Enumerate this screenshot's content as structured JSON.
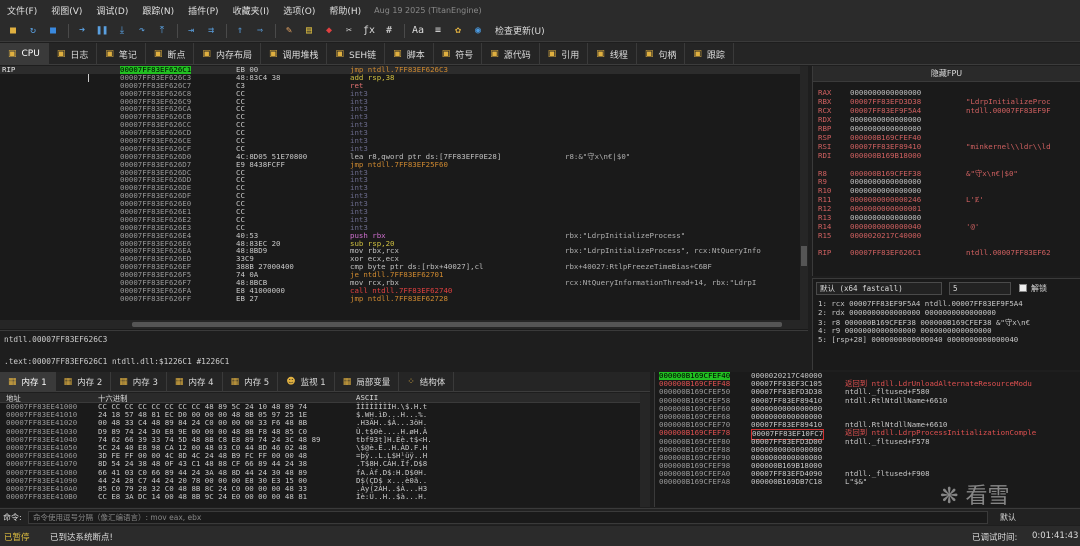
{
  "menubar": {
    "items": [
      "文件(F)",
      "视图(V)",
      "调试(D)",
      "跟踪(N)",
      "插件(P)",
      "收藏夹(I)",
      "选项(O)",
      "帮助(H)"
    ],
    "version": "Aug 19 2025 (TitanEngine)"
  },
  "toolbar": {
    "update_label": "检查更新(U)"
  },
  "tabs": [
    {
      "label": "CPU",
      "icon": "cpu-icon"
    },
    {
      "label": "日志",
      "icon": "log-icon"
    },
    {
      "label": "笔记",
      "icon": "notes-icon"
    },
    {
      "label": "断点",
      "icon": "breakpoint-icon"
    },
    {
      "label": "内存布局",
      "icon": "memory-map-icon"
    },
    {
      "label": "调用堆栈",
      "icon": "call-stack-icon"
    },
    {
      "label": "SEH链",
      "icon": "seh-icon"
    },
    {
      "label": "脚本",
      "icon": "script-icon"
    },
    {
      "label": "符号",
      "icon": "symbols-icon"
    },
    {
      "label": "源代码",
      "icon": "source-icon"
    },
    {
      "label": "引用",
      "icon": "references-icon"
    },
    {
      "label": "线程",
      "icon": "threads-icon"
    },
    {
      "label": "句柄",
      "icon": "handles-icon"
    },
    {
      "label": "跟踪",
      "icon": "trace-icon"
    }
  ],
  "cpu": {
    "rip_label": "RIP",
    "rows": [
      {
        "addr": "00007FF83EF626C1",
        "bytes": "EB 00",
        "asm": "jmp ntdll.7FF83EF626C3",
        "cls": "asm-jmp",
        "cmt": ""
      },
      {
        "addr": "00007FF83EF626C3",
        "bytes": "48:83C4 38",
        "asm": "add rsp,38",
        "cls": "asm-add",
        "cmt": ""
      },
      {
        "addr": "00007FF83EF626C7",
        "bytes": "C3",
        "asm": "ret",
        "cls": "asm-ret",
        "cmt": ""
      },
      {
        "addr": "00007FF83EF626C8",
        "bytes": "CC",
        "asm": "int3",
        "cls": "asm-int",
        "cmt": ""
      },
      {
        "addr": "00007FF83EF626C9",
        "bytes": "CC",
        "asm": "int3",
        "cls": "asm-int",
        "cmt": ""
      },
      {
        "addr": "00007FF83EF626CA",
        "bytes": "CC",
        "asm": "int3",
        "cls": "asm-int",
        "cmt": ""
      },
      {
        "addr": "00007FF83EF626CB",
        "bytes": "CC",
        "asm": "int3",
        "cls": "asm-int",
        "cmt": ""
      },
      {
        "addr": "00007FF83EF626CC",
        "bytes": "CC",
        "asm": "int3",
        "cls": "asm-int",
        "cmt": ""
      },
      {
        "addr": "00007FF83EF626CD",
        "bytes": "CC",
        "asm": "int3",
        "cls": "asm-int",
        "cmt": ""
      },
      {
        "addr": "00007FF83EF626CE",
        "bytes": "CC",
        "asm": "int3",
        "cls": "asm-int",
        "cmt": ""
      },
      {
        "addr": "00007FF83EF626CF",
        "bytes": "CC",
        "asm": "int3",
        "cls": "asm-int",
        "cmt": ""
      },
      {
        "addr": "00007FF83EF626D0",
        "bytes": "4C:8D05 51E70800",
        "asm": "lea r8,qword ptr ds:[7FF83EFF0E28]",
        "cls": "asm-lea",
        "cmt": "r8:&\"守x\\n€|$0\""
      },
      {
        "addr": "00007FF83EF626D7",
        "bytes": "E9 8438FCFF",
        "asm": "jmp ntdll.7FF83EF25F60",
        "cls": "asm-jmp",
        "cmt": ""
      },
      {
        "addr": "00007FF83EF626DC",
        "bytes": "CC",
        "asm": "int3",
        "cls": "asm-int",
        "cmt": ""
      },
      {
        "addr": "00007FF83EF626DD",
        "bytes": "CC",
        "asm": "int3",
        "cls": "asm-int",
        "cmt": ""
      },
      {
        "addr": "00007FF83EF626DE",
        "bytes": "CC",
        "asm": "int3",
        "cls": "asm-int",
        "cmt": ""
      },
      {
        "addr": "00007FF83EF626DF",
        "bytes": "CC",
        "asm": "int3",
        "cls": "asm-int",
        "cmt": ""
      },
      {
        "addr": "00007FF83EF626E0",
        "bytes": "CC",
        "asm": "int3",
        "cls": "asm-int",
        "cmt": ""
      },
      {
        "addr": "00007FF83EF626E1",
        "bytes": "CC",
        "asm": "int3",
        "cls": "asm-int",
        "cmt": ""
      },
      {
        "addr": "00007FF83EF626E2",
        "bytes": "CC",
        "asm": "int3",
        "cls": "asm-int",
        "cmt": ""
      },
      {
        "addr": "00007FF83EF626E3",
        "bytes": "CC",
        "asm": "int3",
        "cls": "asm-int",
        "cmt": ""
      },
      {
        "addr": "00007FF83EF626E4",
        "bytes": "40:53",
        "asm": "push rbx",
        "cls": "asm-push",
        "cmt": "rbx:\"LdrpInitializeProcess\""
      },
      {
        "addr": "00007FF83EF626E6",
        "bytes": "48:83EC 20",
        "asm": "sub rsp,20",
        "cls": "asm-sub",
        "cmt": ""
      },
      {
        "addr": "00007FF83EF626EA",
        "bytes": "48:8BD9",
        "asm": "mov rbx,rcx",
        "cls": "asm-mov",
        "cmt": "rbx:\"LdrpInitializeProcess\", rcx:NtQueryInfo"
      },
      {
        "addr": "00007FF83EF626ED",
        "bytes": "33C9",
        "asm": "xor ecx,ecx",
        "cls": "asm-xor",
        "cmt": ""
      },
      {
        "addr": "00007FF83EF626EF",
        "bytes": "388B 27000400",
        "asm": "cmp byte ptr ds:[rbx+40027],cl",
        "cls": "asm-cmp",
        "cmt": "rbx+40027:RtlpFreezeTimeBias+C6BF"
      },
      {
        "addr": "00007FF83EF626F5",
        "bytes": "74 0A",
        "asm": "je ntdll.7FF83EF62701",
        "cls": "asm-je",
        "cmt": ""
      },
      {
        "addr": "00007FF83EF626F7",
        "bytes": "48:8BCB",
        "asm": "mov rcx,rbx",
        "cls": "asm-mov",
        "cmt": "rcx:NtQueryInformationThread+14, rbx:\"LdrpI"
      },
      {
        "addr": "00007FF83EF626FA",
        "bytes": "E8 41000000",
        "asm": "call ntdll.7FF83EF62740",
        "cls": "asm-call",
        "cmt": ""
      },
      {
        "addr": "00007FF83EF626FF",
        "bytes": "EB 27",
        "asm": "jmp ntdll.7FF83EF62728",
        "cls": "asm-jmp",
        "cmt": ""
      }
    ]
  },
  "info": {
    "line1": "ntdll.00007FF83EF626C3",
    "line2": ".text:00007FF83EF626C1 ntdll.dll:$1226C1 #1226C1"
  },
  "regs": {
    "header": "隐藏FPU",
    "list": [
      {
        "n": "RAX",
        "v": "0000000000000000",
        "s": ""
      },
      {
        "n": "RBX",
        "v": "00007FF83EFD3D38",
        "s": "\"LdrpInitializeProc"
      },
      {
        "n": "RCX",
        "v": "00007FF83EF9F5A4",
        "s": "ntdll.00007FF83EF9F"
      },
      {
        "n": "RDX",
        "v": "0000000000000000",
        "s": ""
      },
      {
        "n": "RBP",
        "v": "0000000000000000",
        "s": ""
      },
      {
        "n": "RSP",
        "v": "000000B169CFEF40",
        "s": ""
      },
      {
        "n": "RSI",
        "v": "00007FF83EF89410",
        "s": "\"minkernel\\\\ldr\\\\ld"
      },
      {
        "n": "RDI",
        "v": "000000B169B18000",
        "s": ""
      },
      {
        "n": "R8",
        "v": "000000B169CFEF38",
        "s": "&\"守x\\n€|$0\""
      },
      {
        "n": "R9",
        "v": "0000000000000000",
        "s": ""
      },
      {
        "n": "R10",
        "v": "0000000000000000",
        "s": ""
      },
      {
        "n": "R11",
        "v": "0000000000000246",
        "s": "L'Ɇ'"
      },
      {
        "n": "R12",
        "v": "0000000000000001",
        "s": ""
      },
      {
        "n": "R13",
        "v": "0000000000000000",
        "s": ""
      },
      {
        "n": "R14",
        "v": "0000000000000040",
        "s": "'@'"
      },
      {
        "n": "R15",
        "v": "0000020217C40000",
        "s": ""
      },
      {
        "n": "RIP",
        "v": "00007FF83EF626C1",
        "s": "ntdll.00007FF83EF62"
      }
    ]
  },
  "callconv": {
    "mode": "默认 (x64 fastcall)",
    "count": "5",
    "unlock": "解锁",
    "lines": [
      "1: rcx 00007FF83EF9F5A4 ntdll.00007FF83EF9F5A4",
      "2: rdx 0000000000000000 0000000000000000",
      "3: r8 000000B169CFEF38 000000B169CFEF38 &\"守x\\n€",
      "4: r9 0000000000000000 0000000000000000",
      "5: [rsp+28] 0000000000000040 0000000000000040"
    ]
  },
  "btabs": [
    {
      "label": "内存 1",
      "icon": "memory-icon"
    },
    {
      "label": "内存 2",
      "icon": "memory-icon"
    },
    {
      "label": "内存 3",
      "icon": "memory-icon"
    },
    {
      "label": "内存 4",
      "icon": "memory-icon"
    },
    {
      "label": "内存 5",
      "icon": "memory-icon"
    },
    {
      "label": "监视 1",
      "icon": "watch-icon"
    },
    {
      "label": "局部变量",
      "icon": "locals-icon"
    },
    {
      "label": "结构体",
      "icon": "struct-icon"
    }
  ],
  "dump": {
    "headers": [
      "地址",
      "十六进制",
      "ASCII"
    ],
    "rows": [
      {
        "a": "00007FF83EE41000",
        "h": "CC CC CC CC CC CC CC CC 48 89 5C 24 10 48 89 74",
        "t": "ÌÌÌÌÌÌÌÌH.\\$.H.t"
      },
      {
        "a": "00007FF83EE41010",
        "h": "24 18 57 48 81 EC D0 00 00 00 48 8B 05 97 25 1E",
        "t": "$.WH.ìÐ...H...%."
      },
      {
        "a": "00007FF83EE41020",
        "h": "00 48 33 C4 48 89 84 24 C0 00 00 00 33 F6 48 8B",
        "t": ".H3ÄH..$À...3öH."
      },
      {
        "a": "00007FF83EE41030",
        "h": "D9 89 74 24 30 E8 9E 00 00 00 48 8B F8 48 85 C0",
        "t": "Ù.t$0è....H.øH.À"
      },
      {
        "a": "00007FF83EE41040",
        "h": "74 62 66 39 33 74 5D 48 8B C8 E8 89 74 24 3C 48 89",
        "t": "tbf93t]H.Èè.t$<H."
      },
      {
        "a": "00007FF83EE41050",
        "h": "5C 24 40 E8 98 CA 12 00 48 03 C0 44 8D 46 02 48",
        "t": "\\$@è.Ê..H.ÀD.F.H"
      },
      {
        "a": "00007FF83EE41060",
        "h": "3D FE FF 00 00 4C 8D 4C 24 48 B9 FC FF 00 00 48",
        "t": "=þÿ..L.L$H¹üÿ..H"
      },
      {
        "a": "00007FF83EE41070",
        "h": "8D 54 24 38 48 0F 43 C1 48 88 CF 66 89 44 24 38",
        "t": ".T$8H.CÁH.Ïf.D$8"
      },
      {
        "a": "00007FF83EE41080",
        "h": "66 41 03 C0 66 89 44 24 3A 48 8D 44 24 30 48 89",
        "t": "fA.Àf.D$:H.D$0H."
      },
      {
        "a": "00007FF83EE41090",
        "h": "44 24 28 C7 44 24 20 78 00 00 00 E8 30 E3 15 00",
        "t": "D$(ÇD$ x...è0ã.."
      },
      {
        "a": "00007FF83EE410A0",
        "h": "85 C0 79 28 32 C0 48 8B 8C 24 C0 00 00 00 48 33",
        "t": ".Ày(2ÀH..$À...H3"
      },
      {
        "a": "00007FF83EE410B0",
        "h": "CC E8 3A DC 14 00 48 8B 9C 24 E0 00 00 00 48 81",
        "t": "Ìè:Ü..H..$à...H."
      }
    ]
  },
  "stack": {
    "rows": [
      {
        "a": "000000B169CFEF40",
        "v": "0000020217C40000",
        "c": "",
        "cls": "cur"
      },
      {
        "a": "000000B169CFEF48",
        "v": "00007FF83EF3C105",
        "c": "返回到 ntdll.LdrUnloadAlternateResourceModu",
        "cls": "hl",
        "ret": true
      },
      {
        "a": "000000B169CFEF50",
        "v": "00007FF83EFD3D38",
        "c": "ntdll._fltused+F580",
        "cls": ""
      },
      {
        "a": "000000B169CFEF58",
        "v": "00007FF83EF89410",
        "c": "ntdll.RtlNtdllName+6610",
        "cls": ""
      },
      {
        "a": "000000B169CFEF60",
        "v": "0000000000000000",
        "c": "",
        "cls": ""
      },
      {
        "a": "000000B169CFEF68",
        "v": "0000000000000000",
        "c": "",
        "cls": ""
      },
      {
        "a": "000000B169CFEF70",
        "v": "00007FF83EF89410",
        "c": "ntdll.RtlNtdllName+6610",
        "cls": ""
      },
      {
        "a": "000000B169CFEF78",
        "v": "00007FF83EF10FC7",
        "c": "返回到 ntdll.LdrpProcessInitializationComple",
        "cls": "hl box",
        "ret": true
      },
      {
        "a": "000000B169CFEF80",
        "v": "00007FF83EFD3D00",
        "c": "ntdll._fltused+F578",
        "cls": ""
      },
      {
        "a": "000000B169CFEF88",
        "v": "0000000000000000",
        "c": "",
        "cls": ""
      },
      {
        "a": "000000B169CFEF90",
        "v": "0000000000000000",
        "c": "",
        "cls": ""
      },
      {
        "a": "000000B169CFEF98",
        "v": "000000B169B18000",
        "c": "",
        "cls": ""
      },
      {
        "a": "000000B169CFEFA0",
        "v": "00007FF83EFD4090",
        "c": "ntdll._fltused+F908",
        "cls": ""
      },
      {
        "a": "000000B169CFEFA8",
        "v": "000000B169DB7C18",
        "c": "L\"$&\"",
        "cls": ""
      }
    ]
  },
  "cmdbar": {
    "label": "命令:",
    "placeholder": "命令使用逗号分隔（像汇编语言）: mov eax, ebx",
    "default": "默认"
  },
  "status": {
    "state": "已暂停",
    "message": "已到达系统断点!",
    "debug_time_label": "已调试时间:",
    "time": "0:01:41:43"
  },
  "watermark": "看雪"
}
